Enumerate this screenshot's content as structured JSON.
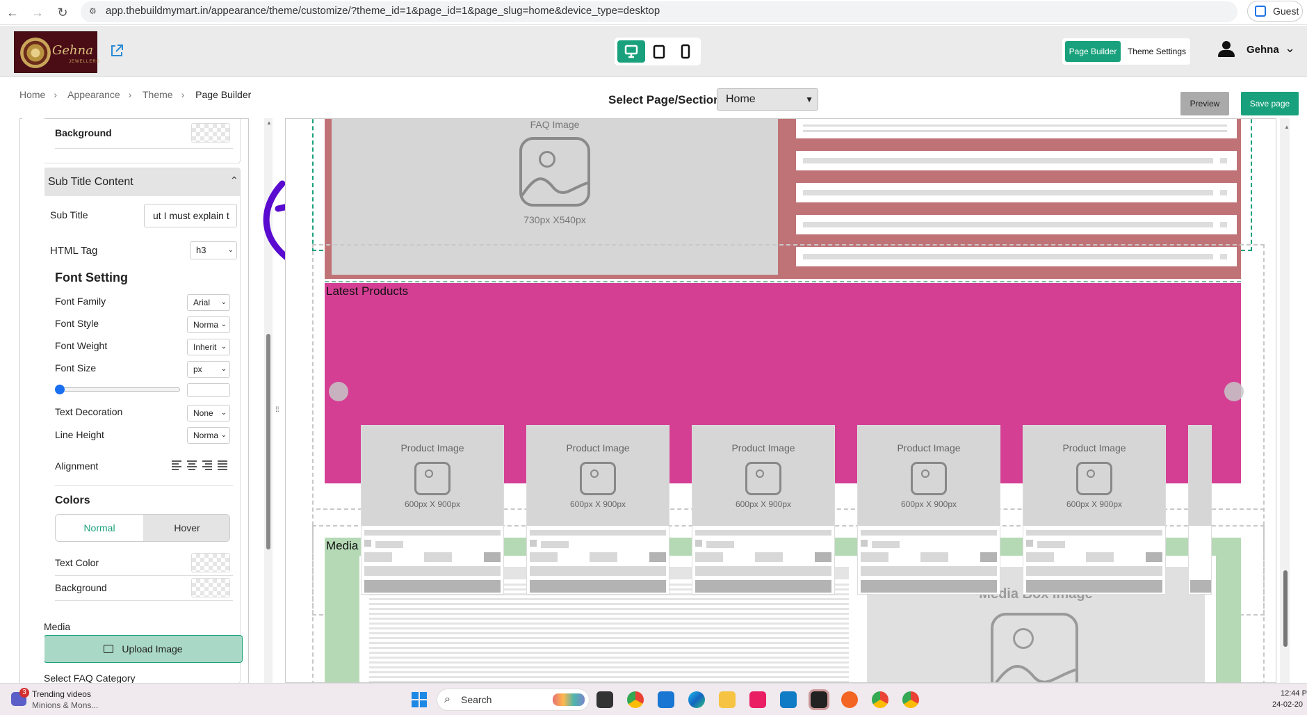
{
  "browser": {
    "url": "app.thebuildmymart.in/appearance/theme/customize/?theme_id=1&page_id=1&page_slug=home&device_type=desktop",
    "profile_label": "Guest"
  },
  "header": {
    "logo_text": "Gehna",
    "logo_sub": "JEWELLERS",
    "page_builder_label": "Page Builder",
    "theme_settings_label": "Theme Settings",
    "user_name": "Gehna",
    "accent_color": "#18a17c"
  },
  "breadcrumb": [
    "Home",
    "Appearance",
    "Theme",
    "Page Builder"
  ],
  "toolbar": {
    "select_label": "Select Page/Section:",
    "select_value": "Home",
    "preview_label": "Preview",
    "save_label": "Save page"
  },
  "panel": {
    "background_label": "Background",
    "section_title": "Sub Title Content",
    "subtitle_label": "Sub Title",
    "subtitle_value": "ut I must explain t",
    "html_tag_label": "HTML Tag",
    "html_tag_value": "h3",
    "font_setting_title": "Font Setting",
    "font_family_label": "Font Family",
    "font_family_value": "Arial",
    "font_style_label": "Font Style",
    "font_style_value": "Norma",
    "font_weight_label": "Font Weight",
    "font_weight_value": "Inherit",
    "font_size_label": "Font Size",
    "font_size_unit": "px",
    "text_decoration_label": "Text Decoration",
    "text_decoration_value": "None",
    "line_height_label": "Line Height",
    "line_height_value": "Norma",
    "alignment_label": "Alignment",
    "colors_title": "Colors",
    "tab_normal": "Normal",
    "tab_hover": "Hover",
    "text_color_label": "Text Color",
    "background2_label": "Background",
    "media_label": "Media",
    "upload_label": "Upload Image",
    "faq_category_label": "Select FAQ Category"
  },
  "canvas": {
    "faq_image_title": "FAQ Image",
    "faq_image_size": "730px X540px",
    "latest_products_title": "Latest Products",
    "product_image_label": "Product Image",
    "product_image_size": "600px X 900px",
    "media_box_title": "Media Box",
    "media_box_image_label": "Media Box Image",
    "faq_bg": "#c07377",
    "products_bg": "#d43f94",
    "media_bg": "#b5d9b5"
  },
  "taskbar": {
    "news_title": "Trending videos",
    "news_sub": "Minions & Mons...",
    "news_badge": "3",
    "search_label": "Search",
    "time": "12:44 P",
    "date": "24-02-20"
  }
}
